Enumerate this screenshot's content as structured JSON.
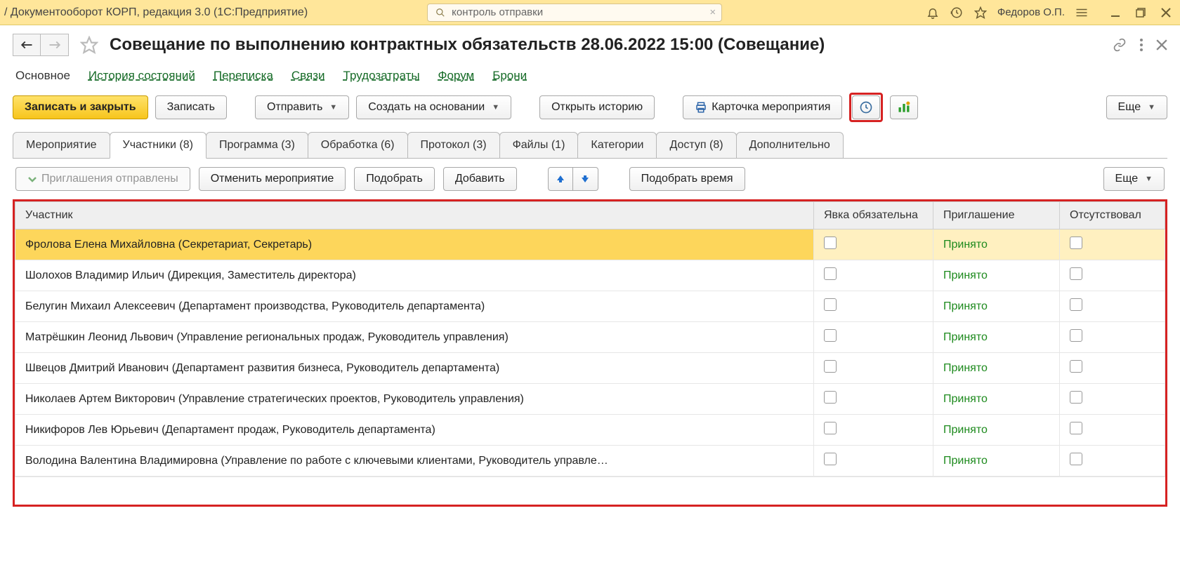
{
  "titlebar": {
    "app_title": "/ Документооборот КОРП, редакция 3.0  (1С:Предприятие)",
    "search_value": "контроль отправки",
    "username": "Федоров О.П."
  },
  "header": {
    "page_title": "Совещание по выполнению контрактных обязательств 28.06.2022 15:00 (Совещание)"
  },
  "section_links": {
    "active": "Основное",
    "items": [
      "История состояний",
      "Переписка",
      "Связи",
      "Трудозатраты",
      "Форум",
      "Брони"
    ]
  },
  "toolbar": {
    "save_close": "Записать и закрыть",
    "save": "Записать",
    "send": "Отправить",
    "create_based_on": "Создать на основании",
    "open_history": "Открыть историю",
    "event_card": "Карточка мероприятия",
    "more": "Еще"
  },
  "tabs": [
    {
      "label": "Мероприятие"
    },
    {
      "label": "Участники (8)"
    },
    {
      "label": "Программа (3)"
    },
    {
      "label": "Обработка (6)"
    },
    {
      "label": "Протокол (3)"
    },
    {
      "label": "Файлы (1)"
    },
    {
      "label": "Категории"
    },
    {
      "label": "Доступ (8)"
    },
    {
      "label": "Дополнительно"
    }
  ],
  "subtoolbar": {
    "invitations_sent": "Приглашения отправлены",
    "cancel_event": "Отменить мероприятие",
    "pick": "Подобрать",
    "add": "Добавить",
    "pick_time": "Подобрать время",
    "more": "Еще"
  },
  "table": {
    "columns": {
      "participant": "Участник",
      "attendance_required": "Явка обязательна",
      "invitation": "Приглашение",
      "absent": "Отсутствовал"
    },
    "rows": [
      {
        "name": "Фролова Елена Михайловна (Секретариат, Секретарь)",
        "invitation": "Принято",
        "selected": true
      },
      {
        "name": "Шолохов Владимир Ильич (Дирекция, Заместитель директора)",
        "invitation": "Принято"
      },
      {
        "name": "Белугин Михаил Алексеевич (Департамент производства, Руководитель департамента)",
        "invitation": "Принято"
      },
      {
        "name": "Матрёшкин Леонид Львович (Управление региональных продаж, Руководитель управления)",
        "invitation": "Принято"
      },
      {
        "name": "Швецов Дмитрий Иванович (Департамент развития бизнеса, Руководитель департамента)",
        "invitation": "Принято"
      },
      {
        "name": "Николаев Артем Викторович (Управление стратегических проектов, Руководитель управления)",
        "invitation": "Принято"
      },
      {
        "name": "Никифоров Лев Юрьевич (Департамент продаж, Руководитель департамента)",
        "invitation": "Принято"
      },
      {
        "name": "Володина Валентина Владимировна (Управление по работе с ключевыми клиентами, Руководитель управле…",
        "invitation": "Принято"
      }
    ]
  }
}
